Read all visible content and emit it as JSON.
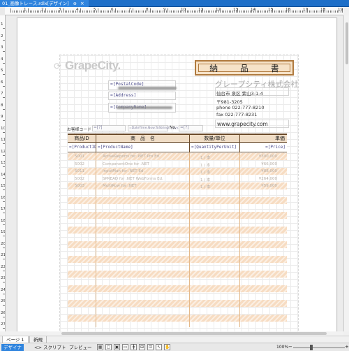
{
  "document_tab": {
    "title": "01_画像トレース.rdlx[デザイン]",
    "pin": "⊕",
    "close": "×"
  },
  "ruler": {
    "h_numbers": [
      "1",
      "2",
      "3",
      "4",
      "5",
      "6",
      "7",
      "8",
      "9",
      "10",
      "11",
      "12",
      "13",
      "14",
      "15",
      "16",
      "17",
      "18",
      "19",
      "20"
    ],
    "v_numbers": [
      "1",
      "2",
      "3",
      "4",
      "5",
      "6",
      "7",
      "8",
      "9",
      "10",
      "11",
      "12",
      "13",
      "14",
      "15",
      "16",
      "17",
      "18",
      "19",
      "20",
      "21",
      "22",
      "23",
      "24",
      "25",
      "26",
      "27"
    ]
  },
  "report": {
    "logo_text": "GrapeCity.",
    "title": "納 品 書",
    "fields": {
      "postal_code": "=[PostalCode]",
      "address": "=[Address]",
      "company_name": "=[CompanyName]"
    },
    "company_name": "グレープシティ株式会社",
    "address_lines": [
      "仙台市 泉区 紫山3-1-4",
      "〒981-3205",
      "phone 022-777-8210",
      "fax 022-777-8231",
      "www.grapecity.com"
    ],
    "filter_row": {
      "customer_code_label": "お客様コード",
      "customer_code": "=[?]",
      "date_label": "=DateTime.Now.ToString(\"yyyy年M月d日\")",
      "no_label": "No.",
      "no_value": "=[?]"
    },
    "table_headers": [
      "商品ID",
      "商　品　名",
      "数量/単位",
      "単価"
    ],
    "data_row": [
      "=[ProductID]",
      "=[ProductName]",
      "=[QuantityPerUnit]",
      "=[Price]"
    ],
    "ghost_rows": [
      [
        "5001",
        "ActiveReports for .NET Pro Ed.",
        "1 / 本",
        "¥300,000"
      ],
      [
        "5002",
        "ComponentOne for .NET",
        "1 / 本",
        "¥66,000"
      ],
      [
        "5011",
        "InputMan for .NET Ed.",
        "1 / 本",
        "¥88,000"
      ],
      [
        "5002",
        "SPREAD for .NET WebForms Ed.",
        "1 / 本",
        "¥264,000"
      ],
      [
        "5003",
        "MultiRow for .NET",
        "1 / 本",
        "¥59,000"
      ]
    ]
  },
  "page_tabs": [
    "ページ 1",
    "新規"
  ],
  "statusbar": {
    "modes": [
      {
        "label": "デザイナ",
        "active": true
      },
      {
        "label": "<> スクリプト",
        "active": false
      },
      {
        "label": "プレビュー",
        "active": false
      }
    ],
    "zoom": "100%",
    "zoom_minus": "−",
    "zoom_plus": "+"
  }
}
